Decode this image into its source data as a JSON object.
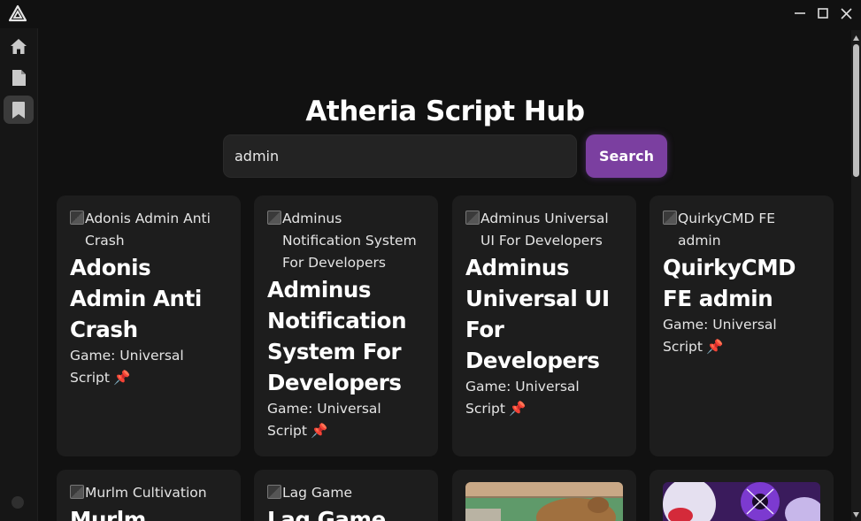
{
  "window": {
    "controls": [
      "minimize",
      "maximize",
      "close"
    ]
  },
  "sidebar": {
    "items": [
      {
        "name": "home",
        "icon": "home-icon"
      },
      {
        "name": "files",
        "icon": "file-icon"
      },
      {
        "name": "bookmarks",
        "icon": "bookmark-icon",
        "active": true
      }
    ]
  },
  "header": {
    "title": "Atheria Script Hub"
  },
  "search": {
    "value": "admin",
    "button_label": "Search"
  },
  "cards": [
    {
      "image_alt": "Adonis Admin Anti Crash",
      "title": "Adonis Admin Anti Crash",
      "meta": "Game: Universal Script",
      "pin": "📌"
    },
    {
      "image_alt": "Adminus Notification System For Developers",
      "title": "Adminus Notification System For Developers",
      "meta": "Game: Universal Script",
      "pin": "📌"
    },
    {
      "image_alt": "Adminus Universal UI For Developers",
      "title": "Adminus Universal UI For Developers",
      "meta": "Game: Universal Script",
      "pin": "📌"
    },
    {
      "image_alt": "QuirkyCMD FE admin",
      "title": "QuirkyCMD FE admin",
      "meta": "Game: Universal Script",
      "pin": "📌"
    },
    {
      "image_alt": "Murlm Cultivation",
      "title": "Murlm"
    },
    {
      "image_alt": "Lag Game",
      "title": "Lag Game"
    },
    {
      "image_alt": ""
    },
    {
      "image_alt": ""
    }
  ],
  "colors": {
    "accent": "#7b3fa0",
    "card_bg": "#1d1d1d",
    "page_bg": "#111111",
    "pin": "#e0344a"
  }
}
